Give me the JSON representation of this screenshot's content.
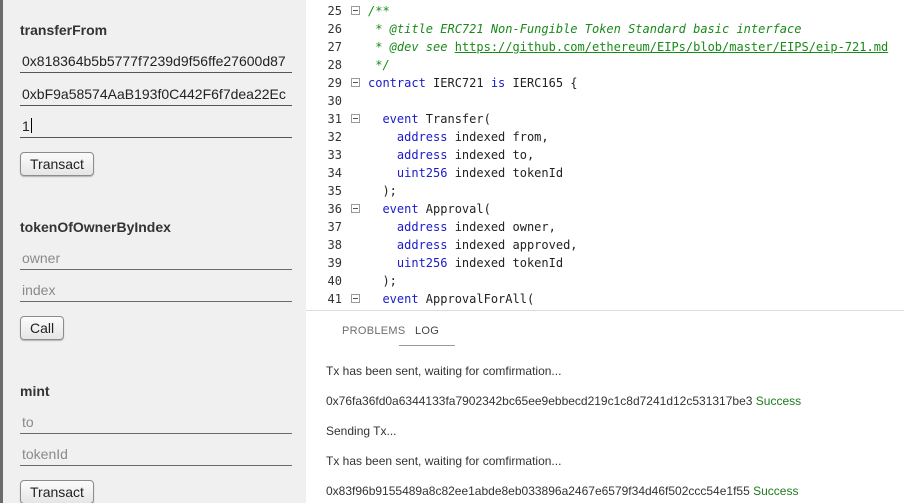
{
  "methods": {
    "transferFrom": {
      "title": "transferFrom",
      "from_value": "0x818364b5b5777f7239d9f56ffe27600d87",
      "to_value": "0xbF9a58574AaB193f0C442F6f7dea22Ec",
      "token_value": "1",
      "button": "Transact"
    },
    "tokenOfOwnerByIndex": {
      "title": "tokenOfOwnerByIndex",
      "owner_placeholder": "owner",
      "index_placeholder": "index",
      "button": "Call"
    },
    "mint": {
      "title": "mint",
      "to_placeholder": "to",
      "tokenId_placeholder": "tokenId",
      "button": "Transact"
    }
  },
  "editor": {
    "lines": [
      {
        "n": "25",
        "t": "/**"
      },
      {
        "n": "26",
        "t": " * @title ERC721 Non-Fungible Token Standard basic interface"
      },
      {
        "n": "27",
        "t": " * @dev see ",
        "url": "https://github.com/ethereum/EIPs/blob/master/EIPS/eip-721.md"
      },
      {
        "n": "28",
        "t": " */"
      },
      {
        "n": "29",
        "kw": "contract",
        "t": " IERC721 ",
        "kw2": "is",
        "t2": " IERC165 {"
      },
      {
        "n": "30",
        "t": ""
      },
      {
        "n": "31",
        "kw": "  event",
        "t": " Transfer("
      },
      {
        "n": "32",
        "ty": "    address",
        "t": " indexed from,"
      },
      {
        "n": "33",
        "ty": "    address",
        "t": " indexed to,"
      },
      {
        "n": "34",
        "ty": "    uint256",
        "t": " indexed tokenId"
      },
      {
        "n": "35",
        "t": "  );"
      },
      {
        "n": "36",
        "kw": "  event",
        "t": " Approval("
      },
      {
        "n": "37",
        "ty": "    address",
        "t": " indexed owner,"
      },
      {
        "n": "38",
        "ty": "    address",
        "t": " indexed approved,"
      },
      {
        "n": "39",
        "ty": "    uint256",
        "t": " indexed tokenId"
      },
      {
        "n": "40",
        "t": "  );"
      },
      {
        "n": "41",
        "kw": "  event",
        "t": " ApprovalForAll("
      }
    ]
  },
  "panel": {
    "tabs": [
      "PROBLEMS",
      "LOG"
    ],
    "log": [
      {
        "text": "Tx has been sent, waiting for comfirmation..."
      },
      {
        "text": "0x76fa36fd0a6344133fa7902342bc65ee9ebbecd219c1c8d7241d12c531317be3",
        "status": "Success"
      },
      {
        "text": "Sending Tx..."
      },
      {
        "text": "Tx has been sent, waiting for comfirmation..."
      },
      {
        "text": "0x83f96b9155489a8c82ee1abde8eb033896a2467e6579f34d46f502ccc54e1f55",
        "status": "Success"
      }
    ]
  }
}
